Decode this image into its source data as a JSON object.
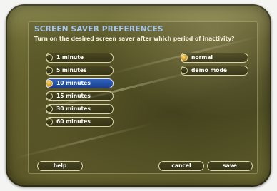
{
  "header": {
    "title": "SCREEN SAVER PREFERENCES",
    "subtitle": "Turn on the desired screen saver after which period of inactivity?"
  },
  "timeout_options": [
    {
      "label": "1 minute",
      "selected": false
    },
    {
      "label": "5 minutes",
      "selected": false
    },
    {
      "label": "10 minutes",
      "selected": true
    },
    {
      "label": "15 minutes",
      "selected": false
    },
    {
      "label": "30 minutes",
      "selected": false
    },
    {
      "label": "60 minutes",
      "selected": false
    }
  ],
  "mode_options": [
    {
      "label": "normal",
      "selected": true
    },
    {
      "label": "demo mode",
      "selected": false
    }
  ],
  "buttons": {
    "help": "help",
    "cancel": "cancel",
    "save": "save"
  },
  "colors": {
    "title": "#a9c6e8",
    "highlight": "#2f63c2",
    "radio_on": "#e0a020",
    "background": "#5e5b2a"
  }
}
